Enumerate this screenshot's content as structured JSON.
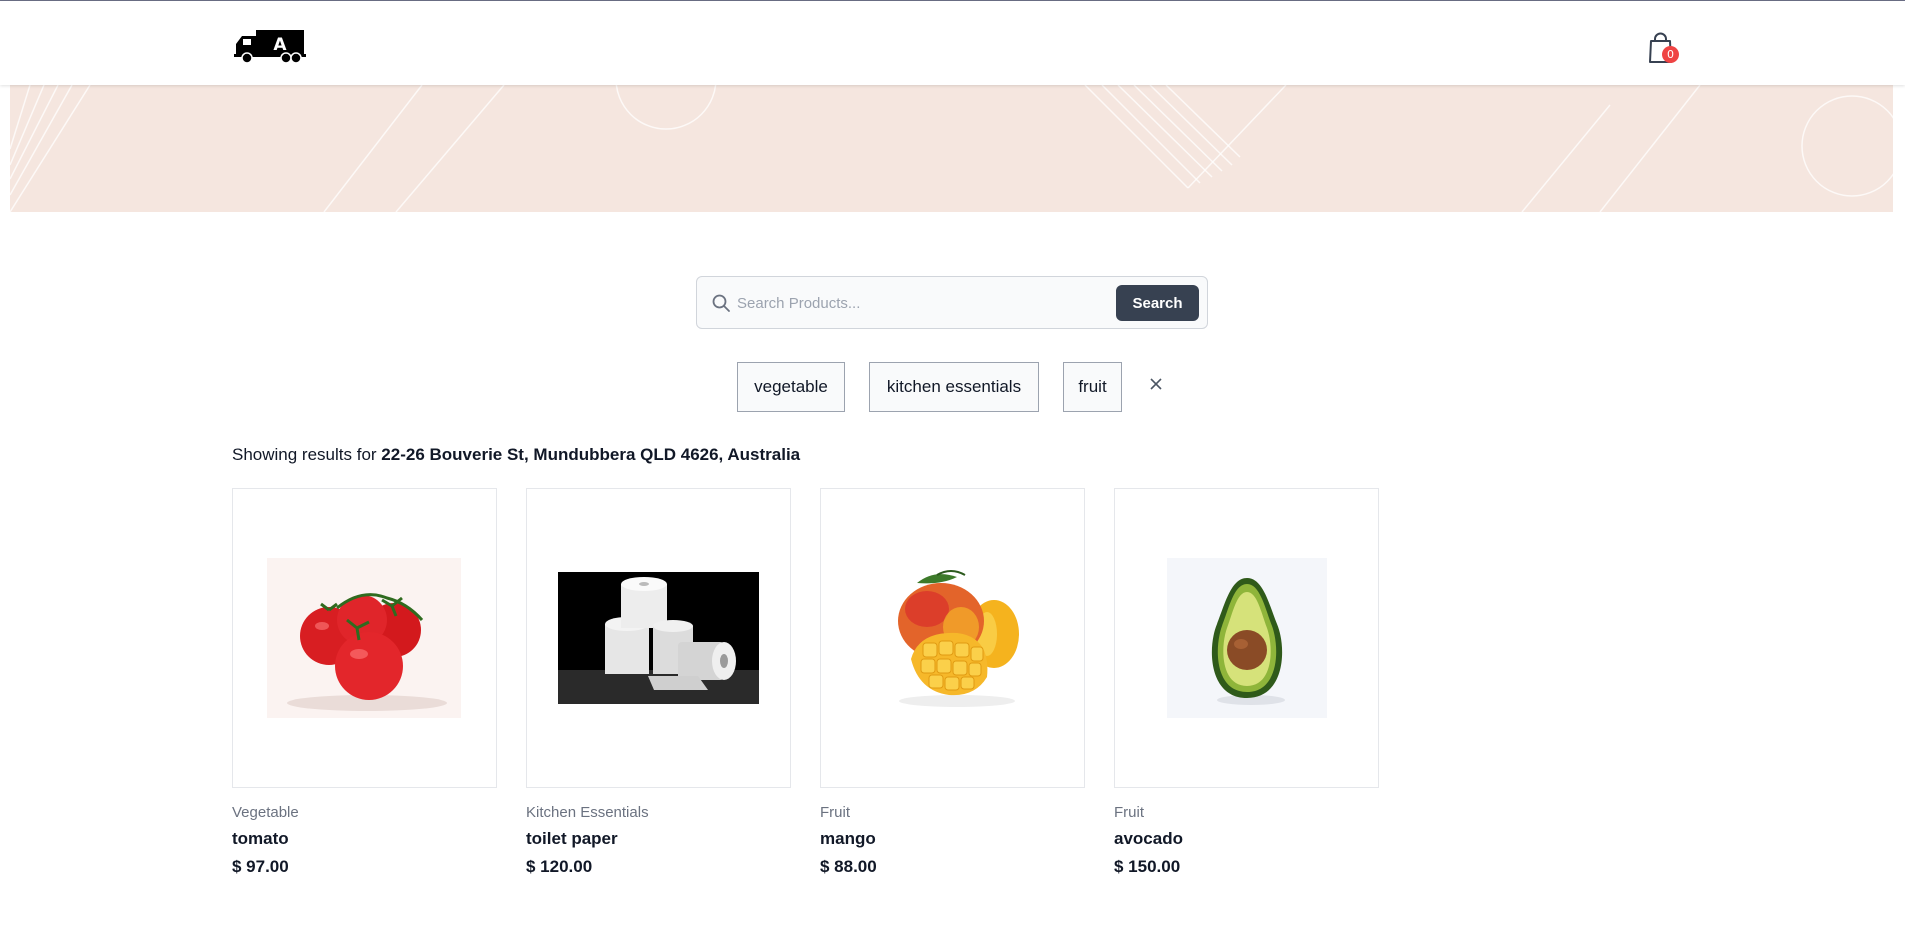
{
  "header": {
    "logo_letter": "A",
    "cart_count": "0"
  },
  "search": {
    "placeholder": "Search Products...",
    "button_label": "Search"
  },
  "filters": {
    "tags": [
      "vegetable",
      "kitchen essentials",
      "fruit"
    ]
  },
  "results": {
    "prefix": "Showing results for ",
    "location": "22-26 Bouverie St, Mundubbera QLD 4626, Australia"
  },
  "products": [
    {
      "category": "Vegetable",
      "name": "tomato",
      "price": "$ 97.00",
      "icon": "tomato-image"
    },
    {
      "category": "Kitchen Essentials",
      "name": "toilet paper",
      "price": "$ 120.00",
      "icon": "toilet-paper-image"
    },
    {
      "category": "Fruit",
      "name": "mango",
      "price": "$ 88.00",
      "icon": "mango-image"
    },
    {
      "category": "Fruit",
      "name": "avocado",
      "price": "$ 150.00",
      "icon": "avocado-image"
    }
  ],
  "colors": {
    "hero_bg": "#f5e6df",
    "search_button": "#374151",
    "badge": "#ef4444"
  }
}
